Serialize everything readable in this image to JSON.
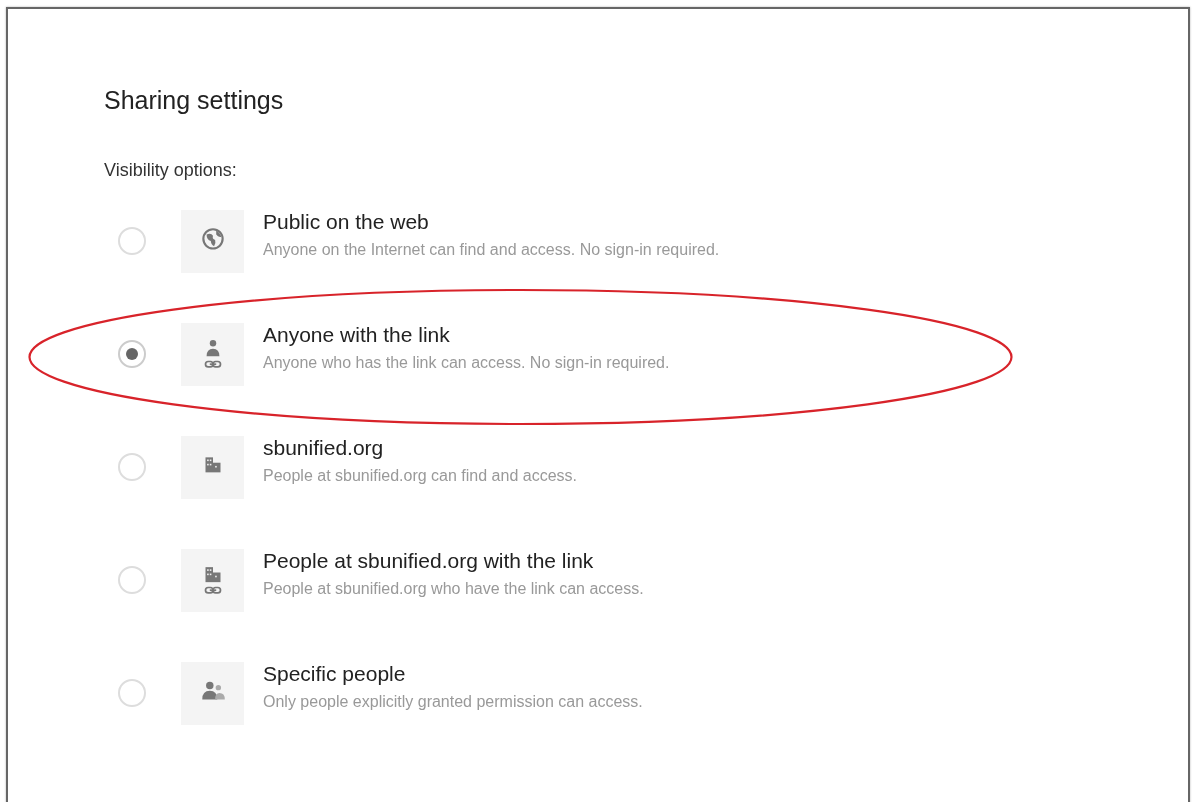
{
  "dialog": {
    "title": "Sharing settings",
    "section_label": "Visibility options:",
    "options": [
      {
        "title": "Public on the web",
        "description": "Anyone on the Internet can find and access. No sign-in required.",
        "selected": false,
        "highlighted": false
      },
      {
        "title": "Anyone with the link",
        "description": "Anyone who has the link can access. No sign-in required.",
        "selected": true,
        "highlighted": true
      },
      {
        "title": "sbunified.org",
        "description": "People at sbunified.org can find and access.",
        "selected": false,
        "highlighted": false
      },
      {
        "title": "People at sbunified.org with the link",
        "description": "People at sbunified.org who have the link can access.",
        "selected": false,
        "highlighted": false
      },
      {
        "title": "Specific people",
        "description": "Only people explicitly granted permission can access.",
        "selected": false,
        "highlighted": false
      }
    ]
  }
}
